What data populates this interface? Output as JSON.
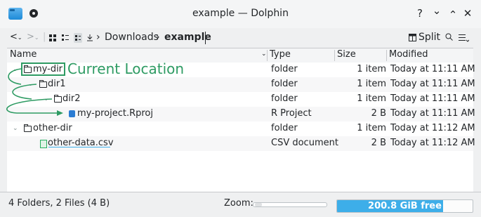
{
  "window": {
    "title": "example — Dolphin",
    "controls": {
      "help": "?",
      "minimize": "⌄",
      "maximize": "⌃",
      "close": "✕"
    }
  },
  "toolbar": {
    "back": "<",
    "forward": ">",
    "breadcrumb": [
      "Downloads",
      "example"
    ],
    "split_label": "Split",
    "search_icon": "search-icon",
    "menu_icon": "hamburger-menu-icon"
  },
  "columns": {
    "name": "Name",
    "type": "Type",
    "size": "Size",
    "modified": "Modified"
  },
  "files": [
    {
      "name": "my-dir",
      "type": "folder",
      "size": "1 item",
      "modified": "Today at 11:11 AM",
      "kind": "folder",
      "expanded": true
    },
    {
      "name": "dir1",
      "type": "folder",
      "size": "1 item",
      "modified": "Today at 11:11 AM",
      "kind": "folder",
      "expanded": true
    },
    {
      "name": "dir2",
      "type": "folder",
      "size": "1 item",
      "modified": "Today at 11:11 AM",
      "kind": "folder",
      "expanded": true
    },
    {
      "name": "my-project.Rproj",
      "type": "R Project",
      "size": "2 B",
      "modified": "Today at 11:11 AM",
      "kind": "rproj"
    },
    {
      "name": "other-dir",
      "type": "folder",
      "size": "1 item",
      "modified": "Today at 11:12 AM",
      "kind": "folder",
      "expanded": true
    },
    {
      "name": "other-data.csv",
      "type": "CSV document",
      "size": "2 B",
      "modified": "Today at 11:12 AM",
      "kind": "csv"
    }
  ],
  "annotation": {
    "label": "Current Location",
    "color": "#2e9b63"
  },
  "status": {
    "summary": "4 Folders, 2 Files (4 B)",
    "zoom_label": "Zoom:",
    "free_space": "200.8 GiB free",
    "free_fraction": 0.78
  },
  "colors": {
    "accent": "#3daee9",
    "annotation": "#2e9b63"
  }
}
